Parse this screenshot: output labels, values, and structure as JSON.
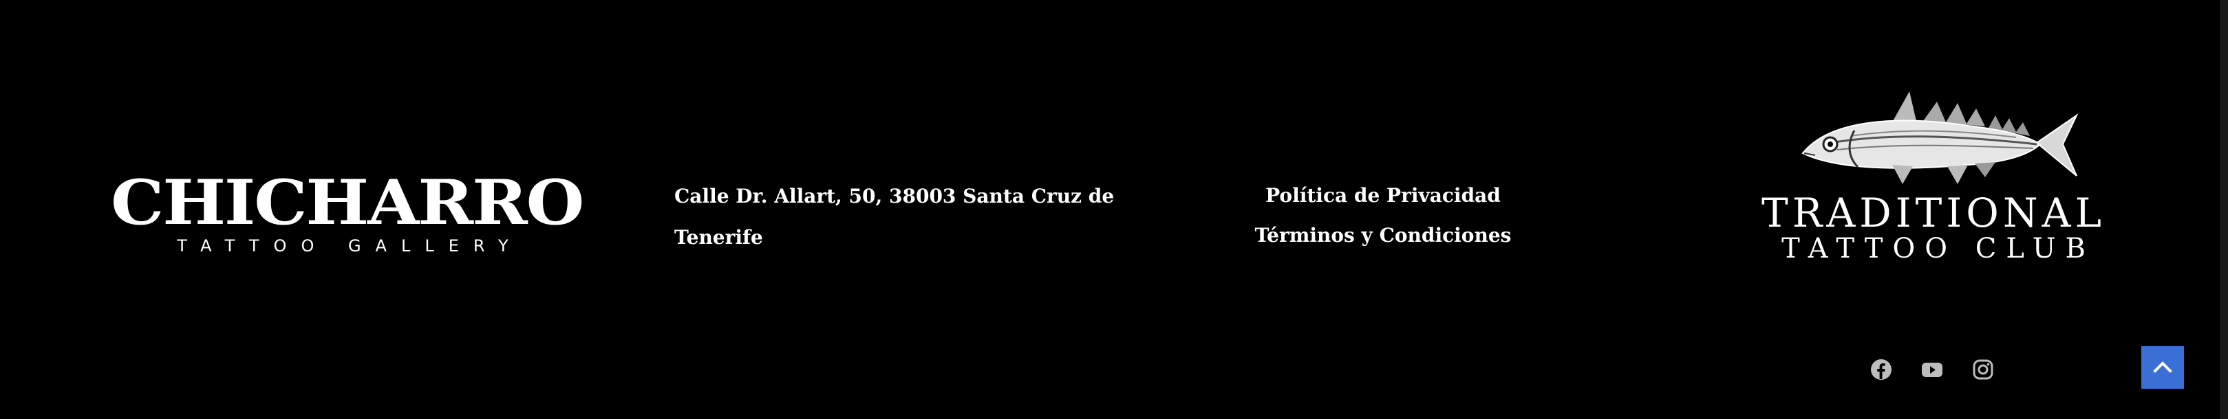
{
  "footer": {
    "logo_left": {
      "title": "CHICHARRO",
      "subtitle": "TATTOO GALLERY"
    },
    "address": "Calle Dr. Allart, 50, 38003 Santa Cruz de Tenerife",
    "links": [
      {
        "label": "Política de Privacidad"
      },
      {
        "label": "Términos y Condiciones"
      }
    ],
    "logo_right": {
      "line1": "TRADITIONAL",
      "line2": "TATTOO CLUB",
      "image": "fish-illustration"
    },
    "social": [
      {
        "icon": "facebook-icon"
      },
      {
        "icon": "youtube-icon"
      },
      {
        "icon": "instagram-icon"
      }
    ],
    "scroll_top": {
      "icon": "chevron-up-icon",
      "color": "#3a6fd6"
    }
  }
}
